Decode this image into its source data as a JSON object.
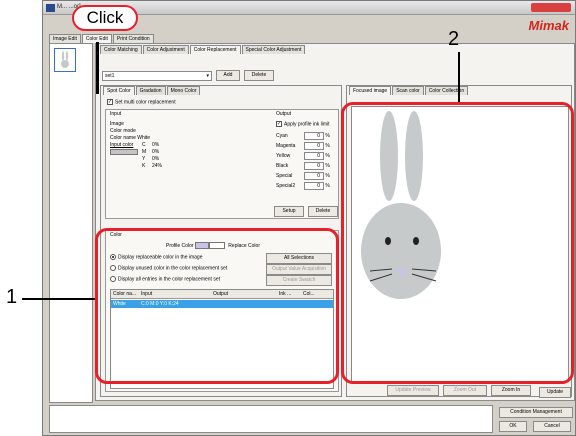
{
  "window": {
    "title": "M...  ...or]"
  },
  "brand": "Mimak",
  "top_tabs": [
    "Image Edit",
    "Color Edit",
    "Print Condition"
  ],
  "sub_tabs": [
    "Color Matching",
    "Color Adjustment",
    "Color Replacement",
    "Special Color Adjustment"
  ],
  "set_name": "set1",
  "add_label": "Add",
  "delete_label": "Delete",
  "inner_tabs": [
    "Spot Color",
    "Gradation",
    "Mono Color"
  ],
  "multi_color_label": "Set multi color replacement",
  "input": {
    "title": "Input",
    "image_label": "Image",
    "color_mode_label": "Color mode",
    "color_name": "Color name White",
    "input_color_label": "Input color",
    "channels": [
      {
        "name": "C",
        "value": "0%"
      },
      {
        "name": "M",
        "value": "0%"
      },
      {
        "name": "Y",
        "value": "0%"
      },
      {
        "name": "K",
        "value": "24%"
      }
    ]
  },
  "output": {
    "title": "Output",
    "apply_profile_label": "Apply profile ink limit",
    "inks": [
      {
        "name": "Cyan",
        "value": "0",
        "unit": "%"
      },
      {
        "name": "Magenta",
        "value": "0",
        "unit": "%"
      },
      {
        "name": "Yellow",
        "value": "0",
        "unit": "%"
      },
      {
        "name": "Black",
        "value": "0",
        "unit": "%"
      },
      {
        "name": "Special",
        "value": "0",
        "unit": "%"
      },
      {
        "name": "Special2",
        "value": "0",
        "unit": "%"
      }
    ],
    "setup_label": "Setup",
    "delete_label": "Delete"
  },
  "color_section": {
    "title": "Color",
    "profile_color_label": "Profile Color",
    "replace_color_label": "Replace Color",
    "options": [
      "Display replaceable color in the image",
      "Display unused color in the color replacement set",
      "Display all entries in the color replacement set"
    ],
    "all_selections_label": "All Selections",
    "output_value_label": "Output Value Acquisition",
    "create_swatch_label": "Create Swatch",
    "table_headers": [
      "Color na...",
      "Input",
      "Output",
      "Ink ...",
      "Col..."
    ],
    "rows": [
      {
        "name": "White",
        "input": "C:0 M:0 Y:0 K:24",
        "output": "",
        "ink": "",
        "col": ""
      }
    ]
  },
  "preview": {
    "tabs": [
      "Focused image",
      "Scan color",
      "Color Collection"
    ],
    "update_preview_label": "Update Preview",
    "zoom_out_label": "Zoom Out",
    "zoom_in_label": "Zoom In"
  },
  "update_label": "Update",
  "condition_management_label": "Condition Management",
  "ok_label": "OK",
  "cancel_label": "Cancel",
  "annotations": {
    "click_label": "Click",
    "label_1": "1",
    "label_2": "2",
    "callout_color": "#e8202a"
  },
  "colors": {
    "rabbit": "#c6cacb",
    "nose": "#c9c3ea",
    "selection": "#3aa0e8",
    "brand": "#d0261c"
  }
}
